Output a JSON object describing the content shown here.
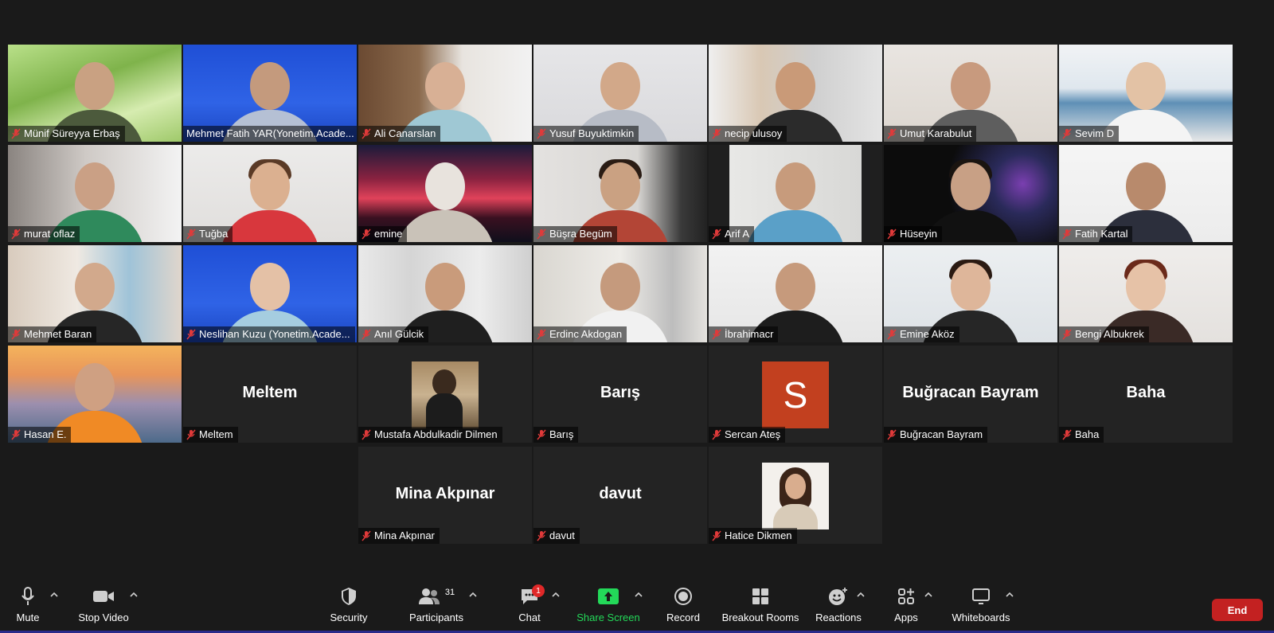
{
  "participants": [
    {
      "name": "Münif Süreyya Erbaş"
    },
    {
      "name": "Mehmet Fatih YAR(Yonetim.Acade..."
    },
    {
      "name": "Ali Canarslan"
    },
    {
      "name": "Yusuf Buyuktimkin"
    },
    {
      "name": "necip ulusoy"
    },
    {
      "name": "Umut Karabulut"
    },
    {
      "name": "Sevim D"
    },
    {
      "name": "murat oflaz"
    },
    {
      "name": "Tuğba"
    },
    {
      "name": "emine"
    },
    {
      "name": "Büşra Begüm"
    },
    {
      "name": "Arif A"
    },
    {
      "name": "Hüseyin"
    },
    {
      "name": "Fatih Kartal"
    },
    {
      "name": "Mehmet Baran"
    },
    {
      "name": "Neslihan Kuzu (Yonetim.Acade..."
    },
    {
      "name": "Anıl Gülcik"
    },
    {
      "name": "Erdinc Akdogan"
    },
    {
      "name": "İbrahimacr"
    },
    {
      "name": "Emine Aköz"
    },
    {
      "name": "Bengi Albukrek"
    },
    {
      "name": "Hasan E."
    },
    {
      "name": "Meltem",
      "display": "Meltem"
    },
    {
      "name": "Mustafa Abdulkadir Dilmen"
    },
    {
      "name": "Barış",
      "display": "Barış"
    },
    {
      "name": "Sercan Ateş",
      "avatar_letter": "S"
    },
    {
      "name": "Buğracan Bayram",
      "display": "Buğracan Bayram"
    },
    {
      "name": "Baha",
      "display": "Baha"
    },
    {
      "name": "Mina Akpınar",
      "display": "Mina Akpınar"
    },
    {
      "name": "davut",
      "display": "davut"
    },
    {
      "name": "Hatice Dikmen"
    }
  ],
  "toolbar": {
    "mute": "Mute",
    "stop_video": "Stop Video",
    "security": "Security",
    "participants": "Participants",
    "participants_count": "31",
    "chat": "Chat",
    "chat_badge": "1",
    "share_screen": "Share Screen",
    "record": "Record",
    "breakout_rooms": "Breakout Rooms",
    "reactions": "Reactions",
    "apps": "Apps",
    "whiteboards": "Whiteboards",
    "end": "End"
  },
  "colors": {
    "active_speaker_border": "#e2e67a",
    "share_screen_green": "#23d959",
    "end_red": "#c32121",
    "badge_red": "#e02828",
    "avatar_orange": "#c2401f"
  }
}
